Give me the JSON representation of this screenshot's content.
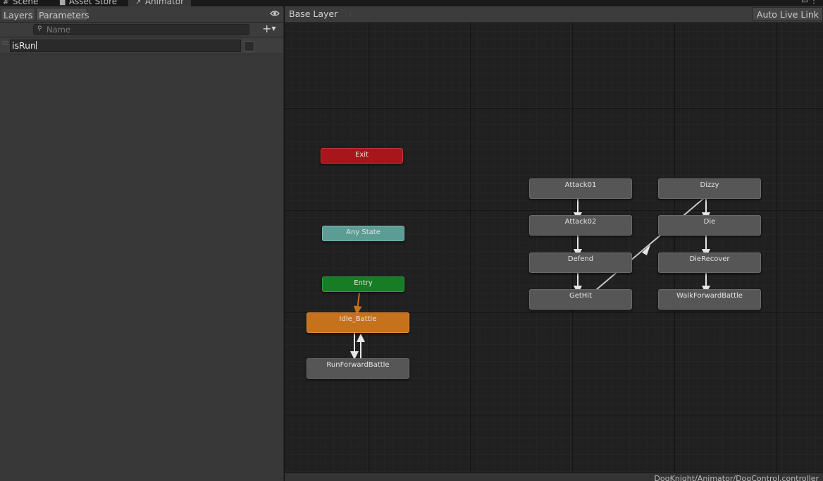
{
  "window_tabs": [
    {
      "label": "Scene",
      "icon": "hash-icon"
    },
    {
      "label": "Asset Store",
      "icon": "bag-icon"
    },
    {
      "label": "Animator",
      "icon": "animator-icon"
    }
  ],
  "left_panel": {
    "tabs": [
      "Layers",
      "Parameters"
    ],
    "search": {
      "placeholder": "Name",
      "value": ""
    },
    "parameters": [
      {
        "name": "isRun",
        "type": "bool",
        "value": false
      }
    ]
  },
  "graph": {
    "breadcrumb": "Base Layer",
    "live_link_label": "Auto Live Link",
    "footer_path": "DogKnight/Animator/DogControl.controller",
    "states": {
      "exit": "Exit",
      "any_state": "Any State",
      "entry": "Entry",
      "idle_battle": "Idle_Battle",
      "run_forward_battle": "RunForwardBattle",
      "attack01": "Attack01",
      "attack02": "Attack02",
      "defend": "Defend",
      "gethit": "GetHit",
      "dizzy": "Dizzy",
      "die": "Die",
      "die_recover": "DieRecover",
      "walk_forward_battle": "WalkForwardBattle"
    }
  },
  "colors": {
    "exit": "#a8151a",
    "any_state": "#5b9d95",
    "entry": "#167d25",
    "default_state": "#c6711c",
    "state": "#565656",
    "transition": "#e6e6e6",
    "entry_transition": "#c6711c"
  }
}
